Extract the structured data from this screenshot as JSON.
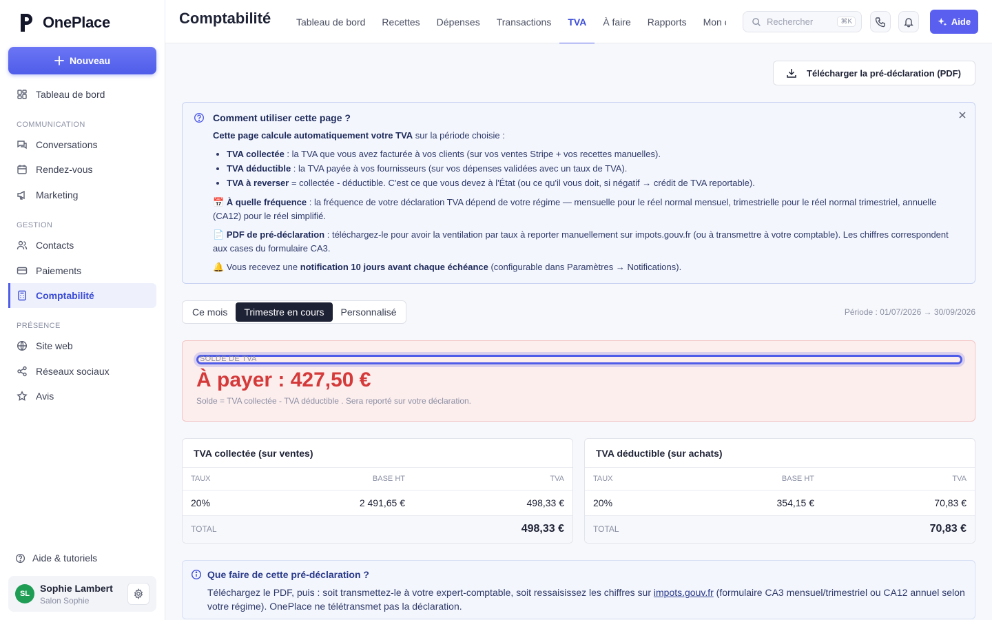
{
  "brand": {
    "name": "OnePlace"
  },
  "sidebar": {
    "new_button": "Nouveau",
    "dashboard": "Tableau de bord",
    "sections": [
      {
        "label": "COMMUNICATION",
        "items": [
          "Conversations",
          "Rendez-vous",
          "Marketing"
        ]
      },
      {
        "label": "GESTION",
        "items": [
          "Contacts",
          "Paiements",
          "Comptabilité"
        ]
      },
      {
        "label": "PRÉSENCE",
        "items": [
          "Site web",
          "Réseaux sociaux",
          "Avis"
        ]
      }
    ],
    "help": "Aide & tutoriels",
    "user": {
      "initials": "SL",
      "name": "Sophie Lambert",
      "business": "Salon Sophie"
    }
  },
  "header": {
    "title": "Comptabilité",
    "tabs": [
      "Tableau de bord",
      "Recettes",
      "Dépenses",
      "Transactions",
      "TVA",
      "À faire",
      "Rapports",
      "Mon co"
    ],
    "active_tab": "TVA",
    "search_placeholder": "Rechercher",
    "search_shortcut": "⌘K",
    "help_button": "Aide"
  },
  "download_button": "Télécharger la pré-déclaration (PDF)",
  "info": {
    "title": "Comment utiliser cette page ?",
    "intro_bold": "Cette page calcule automatiquement votre TVA",
    "intro_rest": " sur la période choisie :",
    "bullets": [
      {
        "bold": "TVA collectée",
        "text": " : la TVA que vous avez facturée à vos clients (sur vos ventes Stripe + vos recettes manuelles)."
      },
      {
        "bold": "TVA déductible",
        "text": " : la TVA payée à vos fournisseurs (sur vos dépenses validées avec un taux de TVA)."
      },
      {
        "bold": "TVA à reverser",
        "text": " = collectée - déductible. C'est ce que vous devez à l'État (ou ce qu'il vous doit, si négatif → crédit de TVA reportable)."
      }
    ],
    "frequency_emoji": "📅",
    "frequency_bold": "À quelle fréquence",
    "frequency_text": " : la fréquence de votre déclaration TVA dépend de votre régime — mensuelle pour le réel normal mensuel, trimestrielle pour le réel normal trimestriel, annuelle (CA12) pour le réel simplifié.",
    "pdf_emoji": "📄",
    "pdf_bold": "PDF de pré-déclaration",
    "pdf_text": " : téléchargez-le pour avoir la ventilation par taux à reporter manuellement sur impots.gouv.fr (ou à transmettre à votre comptable). Les chiffres correspondent aux cases du formulaire CA3.",
    "notif_emoji": "🔔",
    "notif_pre": " Vous recevez une ",
    "notif_bold": "notification 10 jours avant chaque échéance",
    "notif_post": " (configurable dans Paramètres → Notifications)."
  },
  "period": {
    "options": [
      "Ce mois",
      "Trimestre en cours",
      "Personnalisé"
    ],
    "active": "Trimestre en cours",
    "range": "Période : 01/07/2026 → 30/09/2026"
  },
  "balance": {
    "label": "SOLDE DE TVA",
    "amount": "À payer : 427,50 €",
    "note": "Solde = TVA collectée - TVA déductible . Sera reporté sur votre déclaration."
  },
  "collected": {
    "title": "TVA collectée (sur ventes)",
    "headers": [
      "TAUX",
      "BASE HT",
      "TVA"
    ],
    "rows": [
      [
        "20%",
        "2 491,65 €",
        "498,33 €"
      ]
    ],
    "total_label": "TOTAL",
    "total": "498,33 €"
  },
  "deductible": {
    "title": "TVA déductible (sur achats)",
    "headers": [
      "TAUX",
      "BASE HT",
      "TVA"
    ],
    "rows": [
      [
        "20%",
        "354,15 €",
        "70,83 €"
      ]
    ],
    "total_label": "TOTAL",
    "total": "70,83 €"
  },
  "what_to_do": {
    "title": "Que faire de cette pré-déclaration ?",
    "text_pre": "Téléchargez le PDF, puis : soit transmettez-le à votre expert-comptable, soit ressaisissez les chiffres sur ",
    "link": "impots.gouv.fr",
    "text_post": " (formulaire CA3 mensuel/trimestriel ou CA12 annuel selon votre régime). OnePlace ne télétransmet pas la déclaration."
  },
  "colors": {
    "accent": "#4f5ce8",
    "danger": "#d43a3a",
    "balance_bg": "#fdeeee"
  }
}
